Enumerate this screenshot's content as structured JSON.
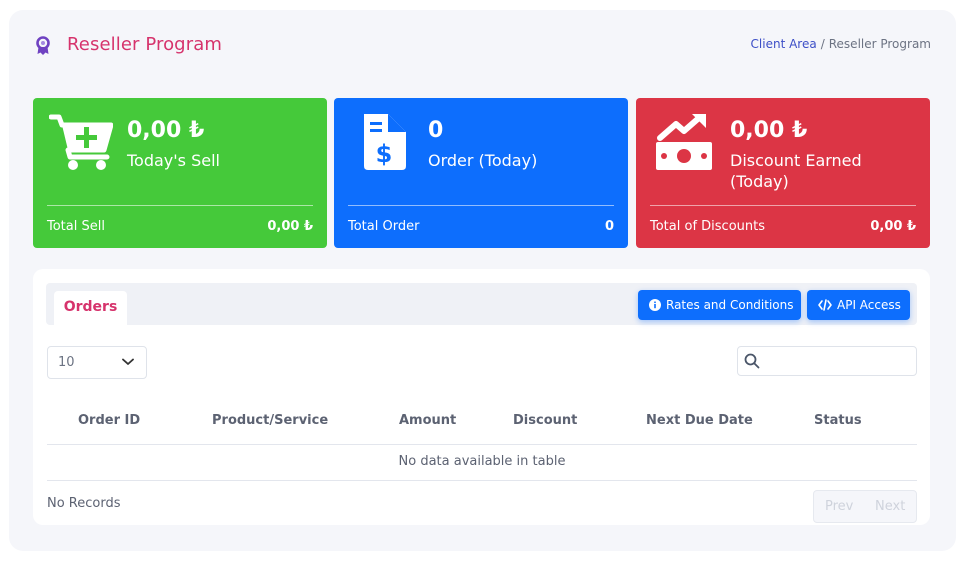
{
  "header": {
    "title": "Reseller Program",
    "breadcrumb": {
      "link": "Client Area",
      "separator": "/",
      "current": "Reseller Program"
    }
  },
  "cards": [
    {
      "icon": "cart-plus-icon",
      "amount": "0,00 ₺",
      "label": "Today's Sell",
      "footer_label": "Total Sell",
      "footer_value": "0,00 ₺",
      "color": "#45c93a"
    },
    {
      "icon": "invoice-dollar-icon",
      "amount": "0",
      "label": "Order (Today)",
      "footer_label": "Total Order",
      "footer_value": "0",
      "color": "#0d6efd"
    },
    {
      "icon": "money-trend-icon",
      "amount": "0,00 ₺",
      "label": "Discount Earned (Today)",
      "footer_label": "Total of Discounts",
      "footer_value": "0,00 ₺",
      "color": "#dc3545"
    }
  ],
  "tabs": {
    "active": "Orders"
  },
  "buttons": {
    "rates": "Rates and Conditions",
    "api": "API Access"
  },
  "table": {
    "page_length": "10",
    "search_placeholder": "",
    "columns": [
      "Order ID",
      "Product/Service",
      "Amount",
      "Discount",
      "Next Due Date",
      "Status"
    ],
    "empty_message": "No data available in table",
    "records_info": "No Records",
    "pagination": {
      "prev": "Prev",
      "next": "Next"
    }
  },
  "colors": {
    "accent": "#d6336c",
    "primary": "#0d6efd",
    "success": "#45c93a",
    "danger": "#dc3545"
  }
}
